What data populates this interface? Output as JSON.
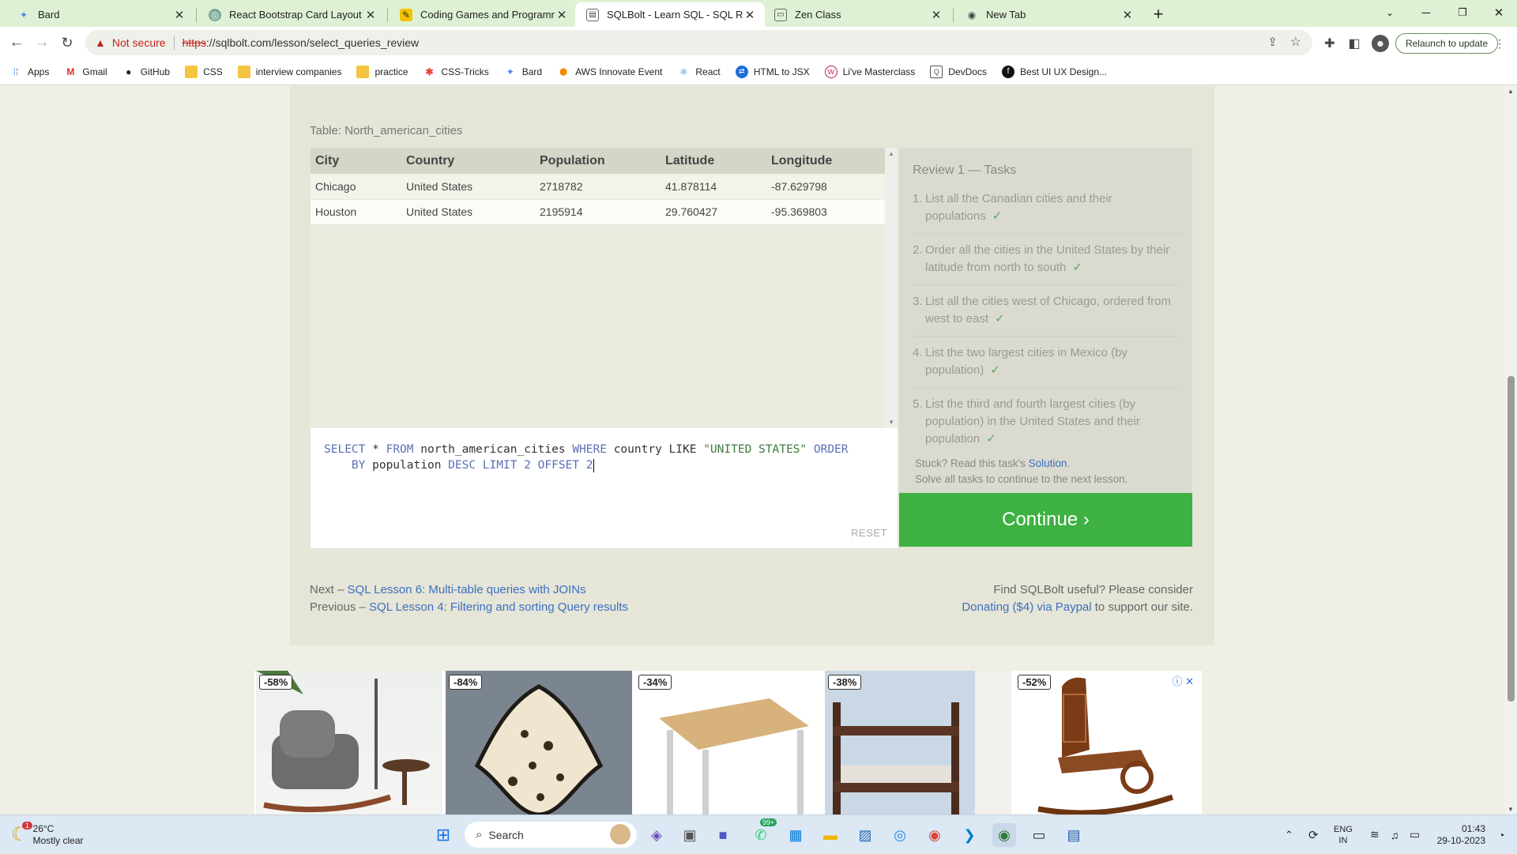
{
  "browser": {
    "tabs": [
      {
        "title": "Bard",
        "icon": "bard-icon",
        "active": false
      },
      {
        "title": "React Bootstrap Card Layout",
        "icon": "openai-icon",
        "active": false
      },
      {
        "title": "Coding Games and Programmin",
        "icon": "codingame-icon",
        "active": false
      },
      {
        "title": "SQLBolt - Learn SQL - SQL Revie",
        "icon": "sqlbolt-icon",
        "active": true
      },
      {
        "title": "Zen Class",
        "icon": "zen-class-icon",
        "active": false
      },
      {
        "title": "New Tab",
        "icon": "chrome-icon",
        "active": false
      }
    ],
    "new_tab_symbol": "+",
    "omnibox": {
      "security_label": "Not secure",
      "url_scheme": "https",
      "url_rest": "://sqlbolt.com/lesson/select_queries_review"
    },
    "relaunch_label": "Relaunch to update",
    "bookmarks": [
      {
        "label": "Apps",
        "icon": "apps-grid-icon"
      },
      {
        "label": "Gmail",
        "icon": "gmail-icon"
      },
      {
        "label": "GitHub",
        "icon": "github-icon"
      },
      {
        "label": "CSS",
        "icon": "folder-icon"
      },
      {
        "label": "interview companies",
        "icon": "folder-icon"
      },
      {
        "label": "practice",
        "icon": "folder-icon"
      },
      {
        "label": "CSS-Tricks",
        "icon": "css-tricks-icon"
      },
      {
        "label": "Bard",
        "icon": "bard-icon"
      },
      {
        "label": "AWS Innovate Event",
        "icon": "aws-icon"
      },
      {
        "label": "React",
        "icon": "react-icon"
      },
      {
        "label": "HTML to JSX",
        "icon": "transform-icon"
      },
      {
        "label": "Li've Masterclass",
        "icon": "masterclass-icon"
      },
      {
        "label": "DevDocs",
        "icon": "devdocs-icon"
      },
      {
        "label": "Best UI UX Design...",
        "icon": "best-ui-icon"
      }
    ]
  },
  "lesson": {
    "table_caption": "Table: North_american_cities",
    "table": {
      "columns": [
        "City",
        "Country",
        "Population",
        "Latitude",
        "Longitude"
      ],
      "rows": [
        [
          "Chicago",
          "United States",
          "2718782",
          "41.878114",
          "-87.629798"
        ],
        [
          "Houston",
          "United States",
          "2195914",
          "29.760427",
          "-95.369803"
        ]
      ]
    },
    "query": {
      "kw_select": "SELECT",
      "star": " * ",
      "kw_from": "FROM",
      "table_name": " north_american_cities ",
      "kw_where": "WHERE",
      "cond": " country LIKE ",
      "str_val": "\"UNITED STATES\"",
      "kw_order": " ORDER",
      "kw_by": "BY",
      "order_col": " population ",
      "kw_desc": "DESC",
      "kw_limit": " LIMIT ",
      "limit_val": "2",
      "kw_offset": " OFFSET ",
      "offset_val": "2"
    },
    "reset_label": "RESET",
    "tasks_title": "Review 1 — Tasks",
    "tasks": [
      {
        "num": "1.",
        "text": "List all the Canadian cities and their populations",
        "check": "✓"
      },
      {
        "num": "2.",
        "text": "Order all the cities in the United States by their latitude from north to south",
        "check": "✓"
      },
      {
        "num": "3.",
        "text": "List all the cities west of Chicago, ordered from west to east",
        "check": "✓"
      },
      {
        "num": "4.",
        "text": "List the two largest cities in Mexico (by population)",
        "check": "✓"
      },
      {
        "num": "5.",
        "text": "List the third and fourth largest cities (by population) in the United States and their population",
        "check": "✓"
      }
    ],
    "stuck_prefix": "Stuck? Read this task's ",
    "stuck_link": "Solution",
    "stuck_suffix": ".",
    "stuck_line2": "Solve all tasks to continue to the next lesson.",
    "continue_label": "Continue ›",
    "next_prefix": "Next – ",
    "next_link": "SQL Lesson 6: Multi-table queries with JOINs",
    "prev_prefix": "Previous – ",
    "prev_link": "SQL Lesson 4: Filtering and sorting Query results",
    "support_line1": "Find SQLBolt useful? Please consider",
    "support_link": "Donating ($4) via Paypal",
    "support_suffix": " to support our site."
  },
  "ads": [
    {
      "discount": "-58%",
      "product": "rocking-lounge-chair-image"
    },
    {
      "discount": "-84%",
      "product": "leopard-rug-image"
    },
    {
      "discount": "-34%",
      "product": "wooden-desk-image"
    },
    {
      "discount": "-38%",
      "product": "bunk-bed-image"
    },
    {
      "discount": "-52%",
      "product": "wooden-rocking-chair-image"
    }
  ],
  "taskbar": {
    "weather_temp": "26°C",
    "weather_desc": "Mostly clear",
    "weather_badge": "1",
    "search_label": "Search",
    "whatsapp_badge": "99+",
    "lang_top": "ENG",
    "lang_bottom": "IN",
    "time": "01:43",
    "date": "29-10-2023"
  },
  "colors": {
    "tabstrip": "#dff1d4",
    "continue_button": "#3db141",
    "link": "#3c70c0",
    "check": "#5aa85a",
    "warning": "#c5221f"
  }
}
